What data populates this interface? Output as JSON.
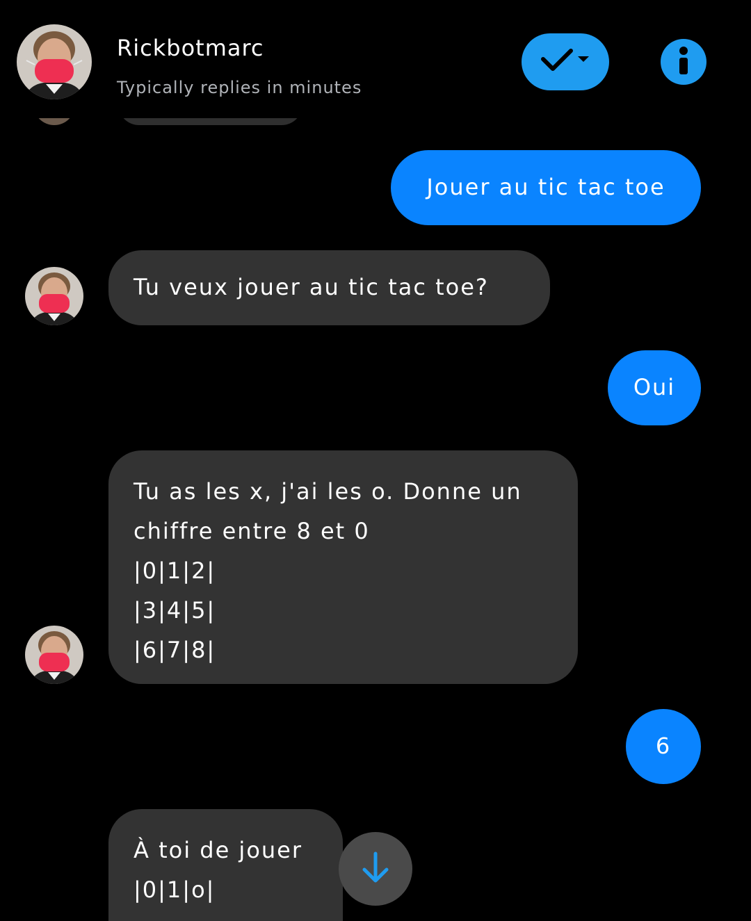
{
  "header": {
    "name": "Rickbotmarc",
    "status": "Typically replies in minutes",
    "status_button_icon": "check-icon",
    "info_icon": "info-icon"
  },
  "messages": [
    {
      "from": "user",
      "lines": [
        "Jouer au tic tac toe"
      ]
    },
    {
      "from": "bot",
      "lines": [
        "Tu veux jouer au tic tac toe?"
      ]
    },
    {
      "from": "user",
      "lines": [
        "Oui"
      ]
    },
    {
      "from": "bot",
      "lines": [
        "Tu as les x, j'ai les o. Donne un",
        "chiffre entre 8 et 0",
        "|0|1|2|",
        "|3|4|5|",
        "|6|7|8|"
      ]
    },
    {
      "from": "user",
      "lines": [
        "6"
      ]
    },
    {
      "from": "bot",
      "lines": [
        "À toi de jouer",
        "|0|1|o|"
      ]
    }
  ],
  "colors": {
    "accent": "#1f9cf0",
    "user_bubble": "#0a84ff",
    "bot_bubble": "#333333",
    "background": "#000000"
  },
  "scroll_button_icon": "arrow-down-icon"
}
